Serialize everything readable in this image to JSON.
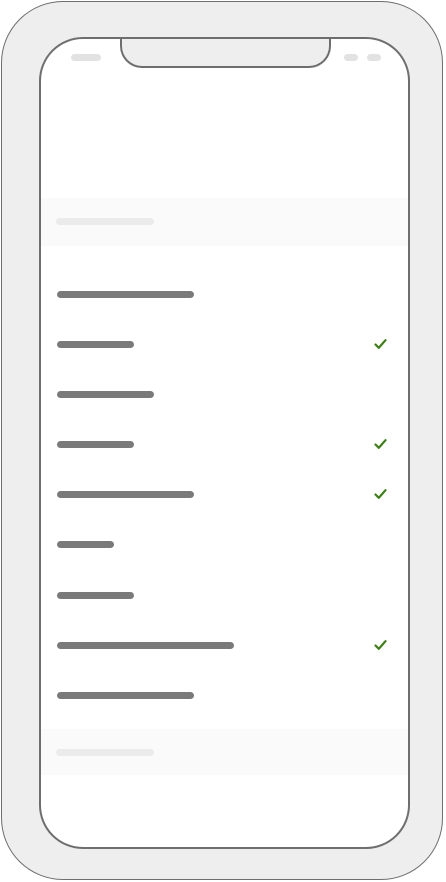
{
  "colors": {
    "frame": "#eeeeee",
    "outline": "#6e6e6e",
    "placeholder": "#7a7a7a",
    "check": "#3d7f14"
  },
  "list": {
    "items": [
      {
        "checked": false,
        "icon": "check-icon"
      },
      {
        "checked": true,
        "icon": "check-icon"
      },
      {
        "checked": false,
        "icon": "check-icon"
      },
      {
        "checked": true,
        "icon": "check-icon"
      },
      {
        "checked": true,
        "icon": "check-icon"
      },
      {
        "checked": false,
        "icon": "check-icon"
      },
      {
        "checked": false,
        "icon": "check-icon"
      },
      {
        "checked": true,
        "icon": "check-icon"
      },
      {
        "checked": false,
        "icon": "check-icon"
      }
    ]
  }
}
